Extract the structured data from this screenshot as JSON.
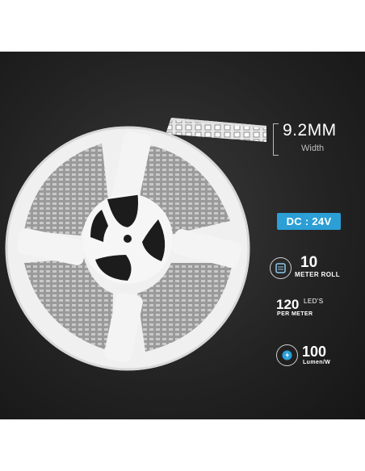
{
  "specs": {
    "width": {
      "value": "9.2MM",
      "label": "Width"
    },
    "voltage": {
      "badge": "DC : 24V"
    },
    "roll": {
      "value": "10",
      "label": "METER ROLL"
    },
    "leds": {
      "value": "120",
      "unit": "LED'S",
      "label": "PER METER"
    },
    "lumen": {
      "value": "100",
      "label": "Lumen/W"
    }
  },
  "icons": [
    "film-roll-icon",
    "light-bulb-icon"
  ],
  "colors": {
    "background": "#1f1f1f",
    "badge": "#2b9fd6",
    "reel": "#f4f4f4",
    "text": "#ffffff"
  }
}
